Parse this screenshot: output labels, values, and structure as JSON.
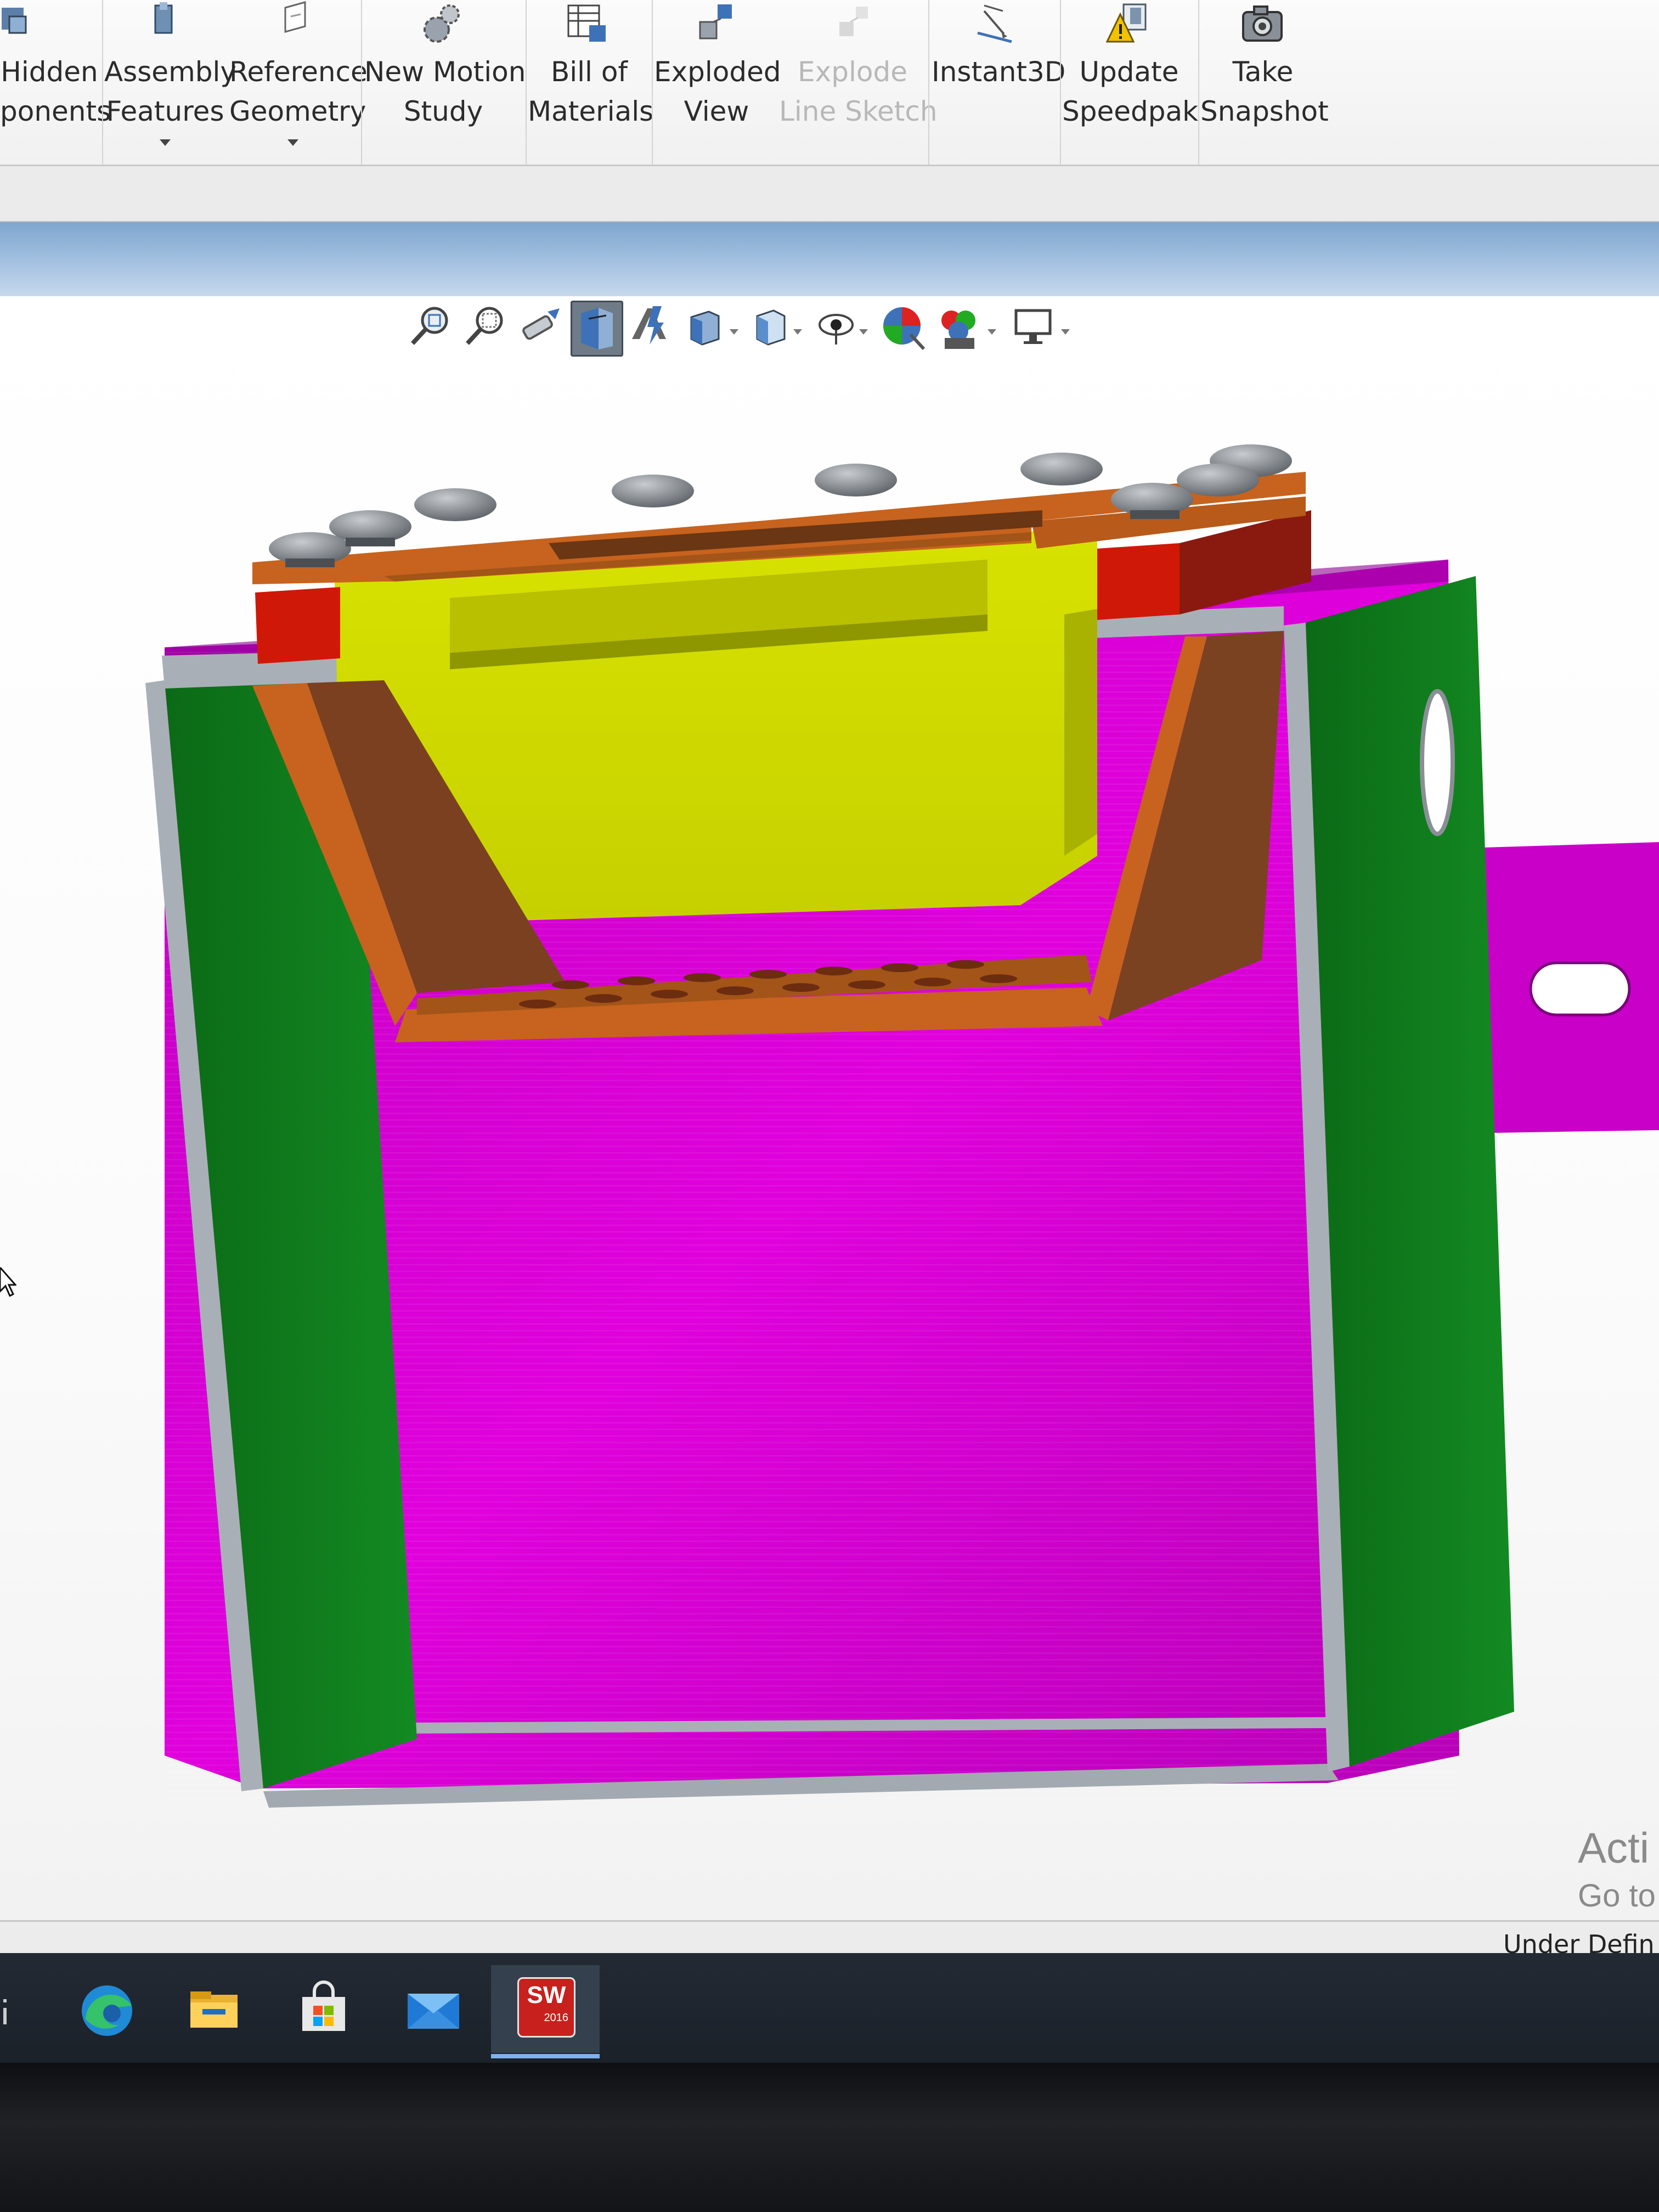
{
  "ribbon": {
    "buttons": [
      {
        "id": "hide-show",
        "icon": "hide-show-components-icon",
        "lines": [
          "Hidden",
          "ponents"
        ],
        "dropdown": false,
        "enabled": true
      },
      {
        "id": "assembly-features",
        "icon": "assembly-features-icon",
        "lines": [
          "Assembly",
          "Features"
        ],
        "dropdown": true,
        "enabled": true
      },
      {
        "id": "reference-geometry",
        "icon": "reference-geometry-icon",
        "lines": [
          "Reference",
          "Geometry"
        ],
        "dropdown": true,
        "enabled": true
      },
      {
        "id": "new-motion-study",
        "icon": "motion-study-icon",
        "lines": [
          "New Motion",
          "Study"
        ],
        "dropdown": false,
        "enabled": true
      },
      {
        "id": "bill-of-materials",
        "icon": "bill-of-materials-icon",
        "lines": [
          "Bill of",
          "Materials"
        ],
        "dropdown": false,
        "enabled": true
      },
      {
        "id": "exploded-view",
        "icon": "exploded-view-icon",
        "lines": [
          "Exploded",
          "View"
        ],
        "dropdown": false,
        "enabled": true
      },
      {
        "id": "explode-line-sketch",
        "icon": "explode-line-sketch-icon",
        "lines": [
          "Explode",
          "Line Sketch"
        ],
        "dropdown": false,
        "enabled": false
      },
      {
        "id": "instant3d",
        "icon": "instant3d-icon",
        "lines": [
          "Instant3D",
          ""
        ],
        "dropdown": false,
        "enabled": true
      },
      {
        "id": "update-speedpak",
        "icon": "update-speedpak-icon",
        "lines": [
          "Update",
          "Speedpak"
        ],
        "dropdown": false,
        "enabled": true
      },
      {
        "id": "take-snapshot",
        "icon": "camera-icon",
        "lines": [
          "Take",
          "Snapshot"
        ],
        "dropdown": false,
        "enabled": true
      }
    ]
  },
  "heads_up_toolbar": {
    "tools": [
      {
        "icon": "zoom-to-fit-icon",
        "dropdown": false,
        "active": false
      },
      {
        "icon": "zoom-to-area-icon",
        "dropdown": false,
        "active": false
      },
      {
        "icon": "previous-view-icon",
        "dropdown": false,
        "active": false
      },
      {
        "icon": "section-view-icon",
        "dropdown": false,
        "active": true
      },
      {
        "icon": "dynamic-annotation-icon",
        "dropdown": false,
        "active": false
      },
      {
        "icon": "view-orientation-icon",
        "dropdown": true,
        "active": false
      },
      {
        "icon": "display-style-icon",
        "dropdown": true,
        "active": false
      },
      {
        "icon": "hide-show-items-icon",
        "dropdown": true,
        "active": false
      },
      {
        "icon": "edit-appearance-icon",
        "dropdown": false,
        "active": false
      },
      {
        "icon": "apply-scene-icon",
        "dropdown": true,
        "active": false
      },
      {
        "icon": "view-settings-icon",
        "dropdown": true,
        "active": false
      }
    ]
  },
  "watermark": {
    "line1": "Acti",
    "line2": "Go to"
  },
  "statusbar": {
    "status": "Under Defin"
  },
  "taskbar": {
    "apps": [
      {
        "icon": "edge-browser-icon",
        "active": false
      },
      {
        "icon": "file-explorer-icon",
        "active": false
      },
      {
        "icon": "microsoft-store-icon",
        "active": false
      },
      {
        "icon": "mail-icon",
        "active": false
      },
      {
        "icon": "solidworks-app-icon",
        "label": "SW",
        "sublabel": "2016",
        "active": true
      }
    ]
  },
  "colors": {
    "housing_magenta": "#d000cc",
    "side_plate_green": "#0f7a1a",
    "tray_yellow": "#ccd800",
    "tray_frame_orange": "#c7631e",
    "block_red": "#d01808",
    "bolt_gray": "#7d8289",
    "rim_gray": "#a9afb6"
  }
}
